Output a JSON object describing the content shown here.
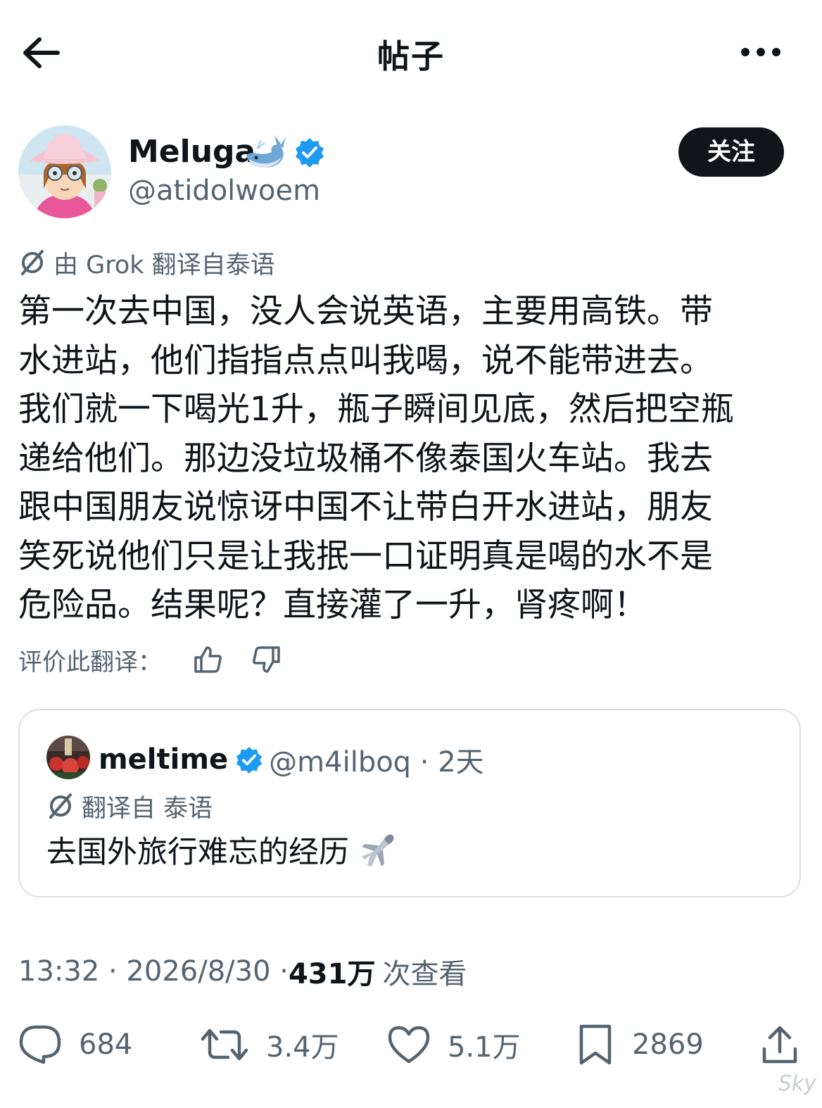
{
  "topbar": {
    "title": "帖子"
  },
  "author": {
    "display_name": "Meluga",
    "handle": "@atidolwoem",
    "follow_label": "关注"
  },
  "translation": {
    "grok_label": "由 Grok 翻译自泰语",
    "rate_label": "评价此翻译："
  },
  "post": {
    "text": "第一次去中国，没人会说英语，主要用高铁。带\n水进站，他们指指点点叫我喝，说不能带进去。\n我们就一下喝光1升，瓶子瞬间见底，然后把空瓶\n递给他们。那边没垃圾桶不像泰国火车站。我去\n跟中国朋友说惊讶中国不让带白开水进站，朋友\n笑死说他们只是让我抿一口证明真是喝的水不是\n危险品。结果呢？直接灌了一升，肾疼啊！"
  },
  "quote": {
    "display_name": "meltime",
    "handle_time": "@m4ilboq · 2天",
    "translate_label": "翻译自 泰语",
    "text": "去国外旅行难忘的经历"
  },
  "meta": {
    "time_date": "13:32 · 2026/8/30 · ",
    "views_count": "431万",
    "views_label": "次查看"
  },
  "actions": {
    "replies": "684",
    "reposts": "3.4万",
    "likes": "5.1万",
    "bookmarks": "2869"
  },
  "watermark": "Sky",
  "colors": {
    "text_primary": "#0f1419",
    "text_secondary": "#536471",
    "verified_blue": "#1d9bf0",
    "border": "#dcdfe2"
  }
}
